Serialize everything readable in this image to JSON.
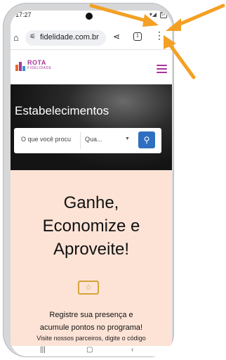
{
  "status": {
    "time": "17:27",
    "battery": "57"
  },
  "browser": {
    "url": "fidelidade.com.br",
    "tab_count": "1"
  },
  "site": {
    "logo_title": "ROTA",
    "logo_subtitle": "FIDELIDADE",
    "hero_title": "Estabelecimentos",
    "search_placeholder": "O que você procu",
    "location_select": "Qua..."
  },
  "content": {
    "headline_line1": "Ganhe,",
    "headline_line2": "Economize e",
    "headline_line3": "Aproveite!",
    "text_line1": "Registre sua presença e",
    "text_line2": "acumule pontos no programa!",
    "text_line3": "Visite nossos parceiros, digite o código"
  },
  "colors": {
    "brand": "#a8339a",
    "search_button": "#2f6fbf",
    "content_bg": "#fde3d6",
    "arrow": "#f4a024"
  },
  "icons": [
    "home-icon",
    "tune-icon",
    "share-icon",
    "tabs-icon",
    "more-vert-icon",
    "hamburger-icon",
    "search-icon",
    "ticket-icon",
    "caret-down-icon",
    "recents-icon",
    "home-nav-icon",
    "back-icon"
  ]
}
